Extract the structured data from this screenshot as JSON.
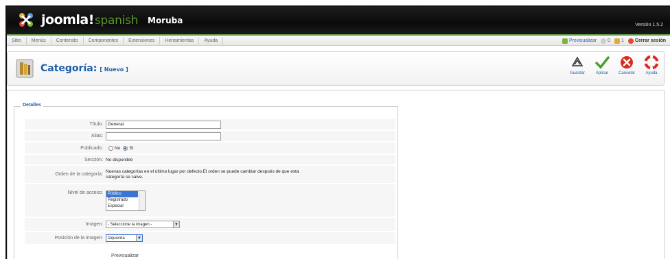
{
  "header": {
    "brand": "joomla!",
    "brand_sub": "spanish",
    "site_name": "Moruba",
    "version": "Versión 1.5.2"
  },
  "menu": {
    "items": [
      "Sitio",
      "Menús",
      "Contenido",
      "Componentes",
      "Extensiones",
      "Herramientas",
      "Ayuda"
    ]
  },
  "status": {
    "preview": "Previsualizar",
    "messages": "0",
    "users": "1",
    "logout": "Cerrar sesión"
  },
  "toolbar": {
    "title": "Categoría:",
    "title_sub": "[ Nuevo ]",
    "buttons": [
      {
        "label": "Guardar",
        "icon": "save-icon"
      },
      {
        "label": "Aplicar",
        "icon": "apply-icon"
      },
      {
        "label": "Cancelar",
        "icon": "cancel-icon"
      },
      {
        "label": "Ayuda",
        "icon": "help-icon"
      }
    ]
  },
  "form": {
    "legend": "Detalles",
    "title_label": "Título:",
    "title_value": "General",
    "alias_label": "Alias:",
    "alias_value": "",
    "published_label": "Publicado:",
    "published_no": "No",
    "published_yes": "Sí",
    "section_label": "Sección:",
    "section_value": "No disponible",
    "order_label": "Orden de la categoría:",
    "order_value": "Nuevas categorías en el último lugar por defecto.El orden se puede cambiar después de que esta categoría se salve.",
    "access_label": "Nivel de acceso:",
    "access_options": [
      "Público",
      "Registrado",
      "Especial"
    ],
    "image_label": "Imagen:",
    "image_value": "- Seleccione la imagen -",
    "image_position_label": "Posición de la imagen:",
    "image_position_value": "Izquierda",
    "preview_label": "Previsualizar"
  },
  "colors": {
    "accent": "#1c5ea8",
    "header_bg": "#111111",
    "menu_border": "#6aa84f"
  }
}
